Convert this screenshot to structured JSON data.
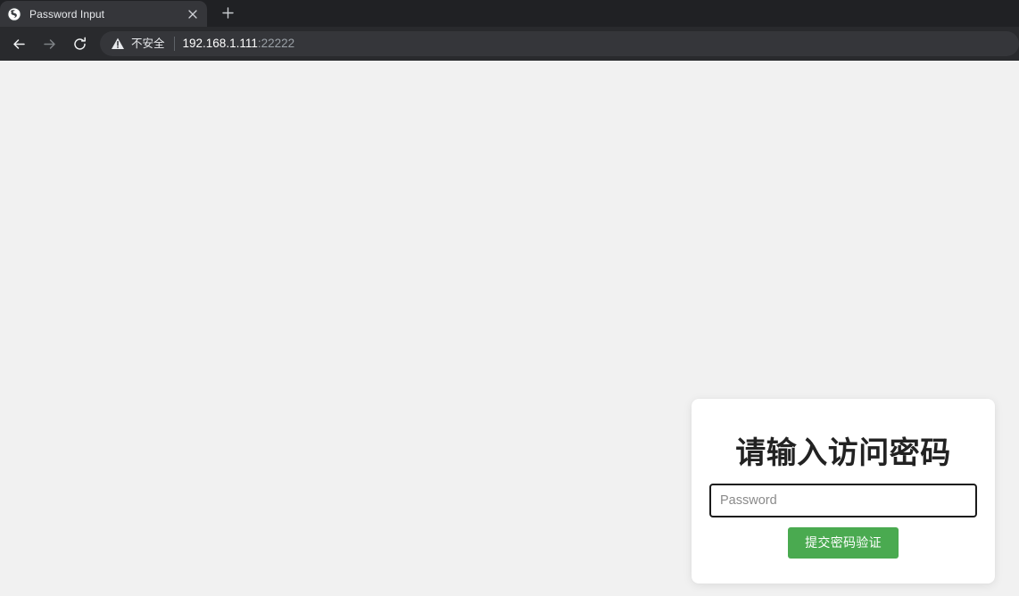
{
  "browser": {
    "tab": {
      "title": "Password Input",
      "favicon_icon": "globe-icon",
      "close_icon": "close-icon"
    },
    "new_tab_icon": "plus-icon",
    "nav": {
      "back_icon": "back-arrow-icon",
      "forward_icon": "forward-arrow-icon",
      "reload_icon": "reload-icon"
    },
    "omnibox": {
      "security_icon": "warning-triangle-icon",
      "security_label": "不安全",
      "url_host": "192.168.1.111",
      "url_port": ":22222"
    }
  },
  "page": {
    "card": {
      "title": "请输入访问密码",
      "password_placeholder": "Password",
      "password_value": "",
      "submit_label": "提交密码验证"
    }
  },
  "colors": {
    "tab_strip_bg": "#202124",
    "active_tab_bg": "#35363a",
    "toolbar_bg": "#292a2d",
    "omnibox_bg": "#35363a",
    "page_bg": "#f1f1f1",
    "card_bg": "#ffffff",
    "submit_green": "#4aaa50",
    "input_border": "#1b1b1b"
  }
}
